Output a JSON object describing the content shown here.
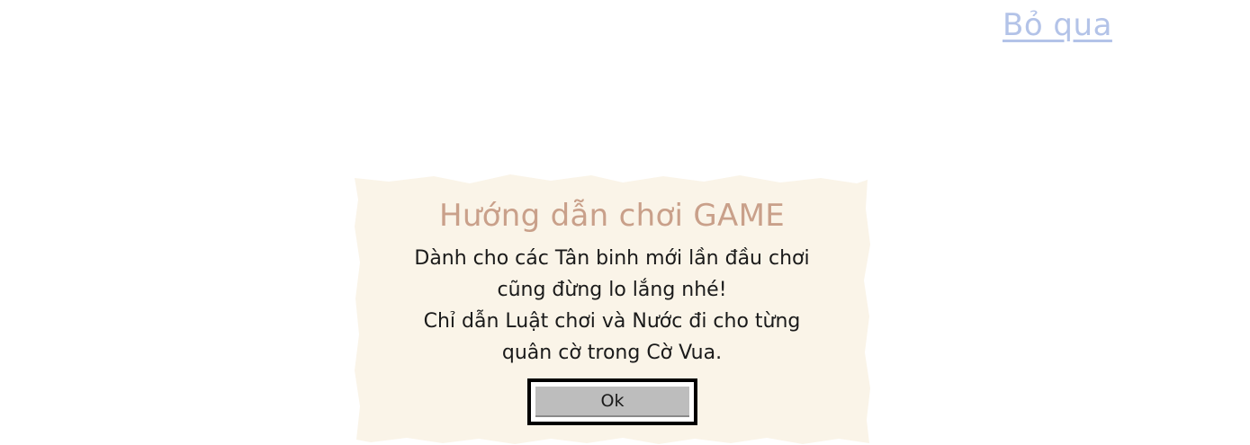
{
  "skip": {
    "label": "Bỏ qua"
  },
  "dialog": {
    "title": "Hướng dẫn chơi GAME",
    "lines": [
      "Dành cho các Tân binh mới lần đầu chơi",
      "cũng đừng lo lắng nhé!",
      "Chỉ dẫn Luật chơi và Nước đi cho từng",
      "quân cờ trong Cờ Vua."
    ],
    "ok_label": "Ok"
  },
  "colors": {
    "paper": "#faf4e8",
    "title": "#c9a08a",
    "skip_link": "#b3c3e8",
    "button_face": "#bdbdbd"
  }
}
